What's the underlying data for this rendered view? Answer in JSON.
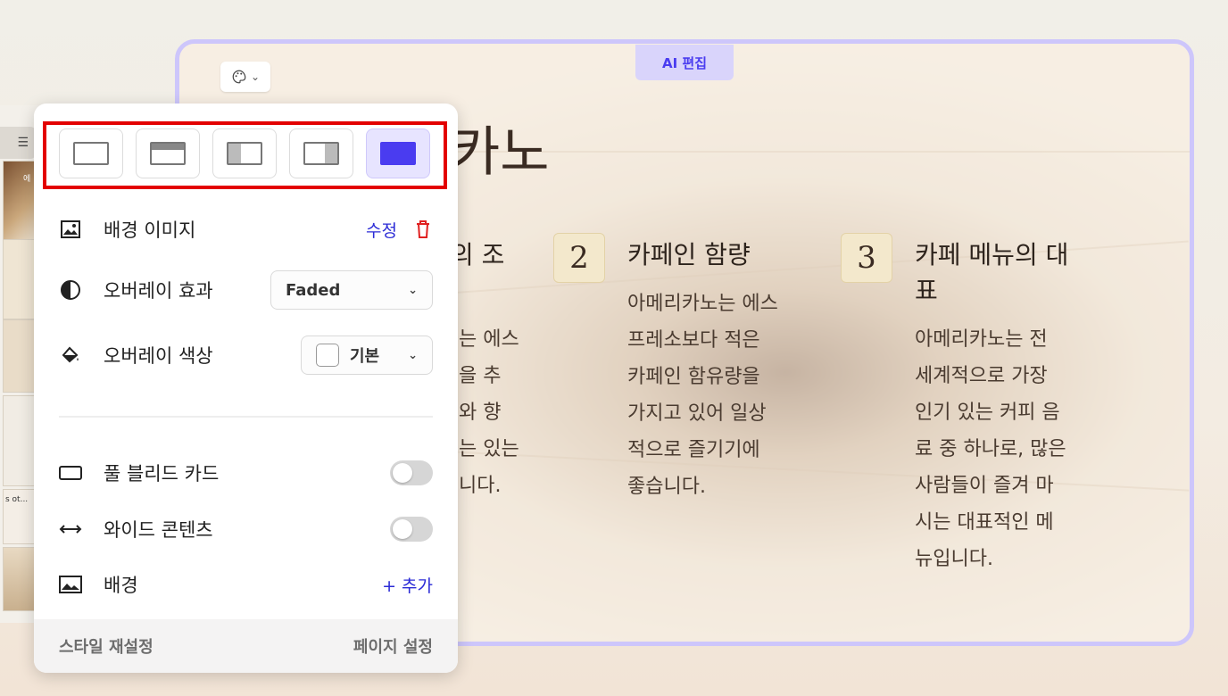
{
  "slide": {
    "ai_tab_label": "AI 편집",
    "title": "카노",
    "columns": [
      {
        "title": "의 조",
        "body": [
          "는 에스",
          "을 추",
          "와 향",
          "는 있는",
          "니다."
        ]
      },
      {
        "number": "2",
        "title": "카페인 함량",
        "body": [
          "아메리카노는 에스",
          "프레소보다 적은",
          "카페인 함유량을",
          "가지고 있어 일상",
          "적으로 즐기기에",
          "좋습니다."
        ]
      },
      {
        "number": "3",
        "title_lines": [
          "카페 메뉴의 대",
          "표"
        ],
        "body": [
          "아메리카노는 전",
          "세계적으로 가장",
          "인기 있는 커피 음",
          "료 중 하나로, 많은",
          "사람들이 즐겨 마",
          "시는 대표적인 메",
          "뉴입니다."
        ]
      }
    ]
  },
  "thumbnails": {
    "t1_text": "에",
    "t5_text": "s ot..."
  },
  "panel": {
    "layout_options": [
      "layout-blank",
      "layout-top-banner",
      "layout-left-image",
      "layout-right-image",
      "layout-full-bleed"
    ],
    "background_image": {
      "label": "배경 이미지",
      "edit_label": "수정"
    },
    "overlay_effect": {
      "label": "오버레이 효과",
      "value": "Faded"
    },
    "overlay_color": {
      "label": "오버레이 색상",
      "value": "기본"
    },
    "full_bleed_card": {
      "label": "풀 블리드 카드"
    },
    "wide_content": {
      "label": "와이드 콘텐츠"
    },
    "background": {
      "label": "배경",
      "add_label": "+ 추가"
    },
    "footer": {
      "reset_label": "스타일 재설정",
      "page_settings_label": "페이지 설정"
    }
  },
  "colors": {
    "accent": "#4a3cf0",
    "highlight": "#e30000",
    "active_layout": "#4a3cf0"
  }
}
